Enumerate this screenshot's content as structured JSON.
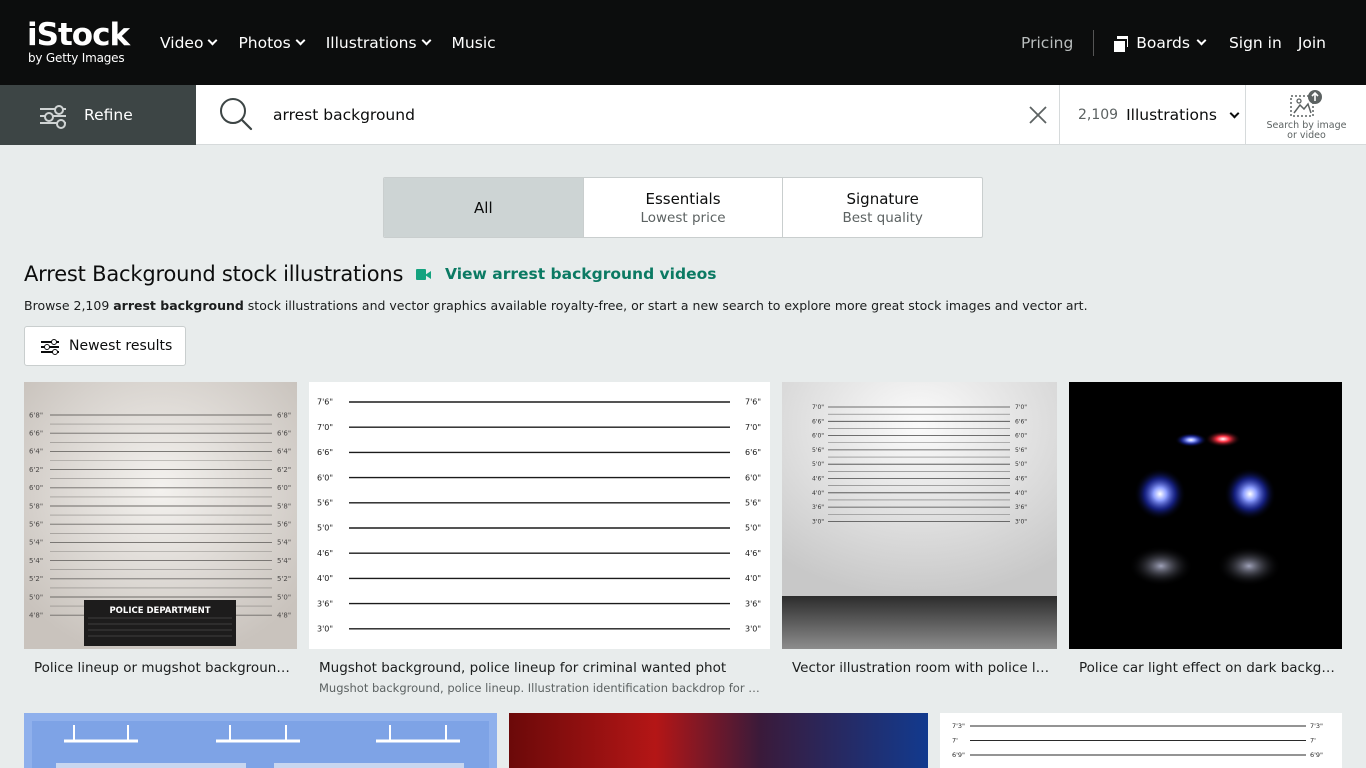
{
  "logo": {
    "main": "iStock",
    "sub": "by Getty Images"
  },
  "nav": {
    "items": [
      {
        "label": "Video",
        "dropdown": true
      },
      {
        "label": "Photos",
        "dropdown": true
      },
      {
        "label": "Illustrations",
        "dropdown": true
      },
      {
        "label": "Music",
        "dropdown": false
      }
    ],
    "pricing": "Pricing",
    "boards": "Boards",
    "signin": "Sign in",
    "join": "Join"
  },
  "search": {
    "refine_label": "Refine",
    "query": "arrest background",
    "result_count": "2,109",
    "asset_type": "Illustrations",
    "image_search_label_1": "Search by image",
    "image_search_label_2": "or video"
  },
  "segments": [
    {
      "label": "All",
      "sub": ""
    },
    {
      "label": "Essentials",
      "sub": "Lowest price"
    },
    {
      "label": "Signature",
      "sub": "Best quality"
    }
  ],
  "heading": {
    "title": "Arrest Background stock illustrations",
    "video_link": "View arrest background videos",
    "browse_prefix": "Browse 2,109 ",
    "browse_bold": "arrest background",
    "browse_suffix": " stock illustrations and vector graphics available royalty-free, or start a new search to explore more great stock images and vector art.",
    "sort_label": "Newest results"
  },
  "results": [
    {
      "caption": "Police lineup or mugshot background with police department sign",
      "sub": "",
      "sign_text": "POLICE DEPARTMENT",
      "heights": [
        "6'8\"",
        "6'6\"",
        "6'4\"",
        "6'2\"",
        "6'0\"",
        "5'8\"",
        "5'6\"",
        "5'4\"",
        "5'4\"",
        "5'2\"",
        "5'0\"",
        "4'8\""
      ]
    },
    {
      "caption": "Mugshot background, police lineup for criminal wanted phot",
      "sub": "Mugshot background, police lineup. Illustration identification backdrop for criminal",
      "heights": [
        "7'6\"",
        "7'0\"",
        "6'6\"",
        "6'0\"",
        "5'6\"",
        "5'0\"",
        "4'6\"",
        "4'0\"",
        "3'6\"",
        "3'0\""
      ]
    },
    {
      "caption": "Vector illustration room with police lineup wall",
      "sub": "",
      "heights": [
        "7'0\"",
        "6'6\"",
        "6'0\"",
        "5'6\"",
        "5'0\"",
        "4'6\"",
        "4'0\"",
        "3'6\"",
        "3'0\""
      ]
    },
    {
      "caption": "Police car light effect on dark background",
      "sub": ""
    }
  ],
  "row2": {
    "heights": [
      "7'3\"",
      "7'",
      "6'9\""
    ]
  },
  "colors": {
    "nav_bg": "#0c0d0d",
    "accent_green": "#0b7a63",
    "page_bg": "#e8ecec"
  }
}
